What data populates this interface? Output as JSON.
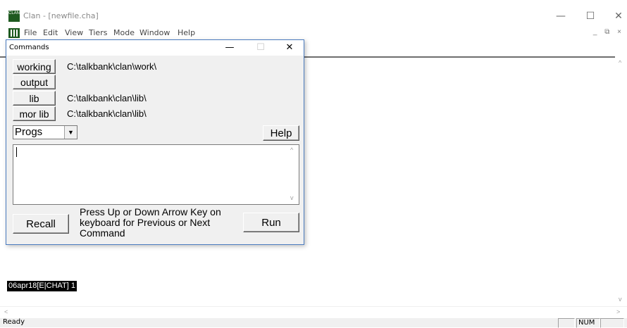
{
  "app": {
    "title": "Clan - [newfile.cha]",
    "icon_text": "CLAN",
    "controls": {
      "minimize": "—",
      "maximize": "☐",
      "close": "✕"
    }
  },
  "menu": {
    "items": [
      "File",
      "Edit",
      "View",
      "Tiers",
      "Mode",
      "Window",
      "Help"
    ],
    "mdi_controls": "_ ⧉ ×"
  },
  "commands": {
    "title": "Commands",
    "controls": {
      "minimize": "—",
      "maximize": "☐",
      "close": "✕"
    },
    "working_label": "working",
    "working_path": "C:\\talkbank\\clan\\work\\",
    "output_label": "output",
    "output_path": "",
    "lib_label": "lib",
    "lib_path": "C:\\talkbank\\clan\\lib\\",
    "morlib_label": "mor lib",
    "morlib_path": "C:\\talkbank\\clan\\lib\\",
    "progs_value": "Progs",
    "help_label": "Help",
    "command_text": "",
    "recall_label": "Recall",
    "hint": "Press Up or Down Arrow Key on keyboard for Previous or Next Command",
    "run_label": "Run"
  },
  "editor": {
    "tier_status": "06apr18[E|CHAT]  1"
  },
  "statusbar": {
    "ready": "Ready",
    "num": "NUM"
  }
}
